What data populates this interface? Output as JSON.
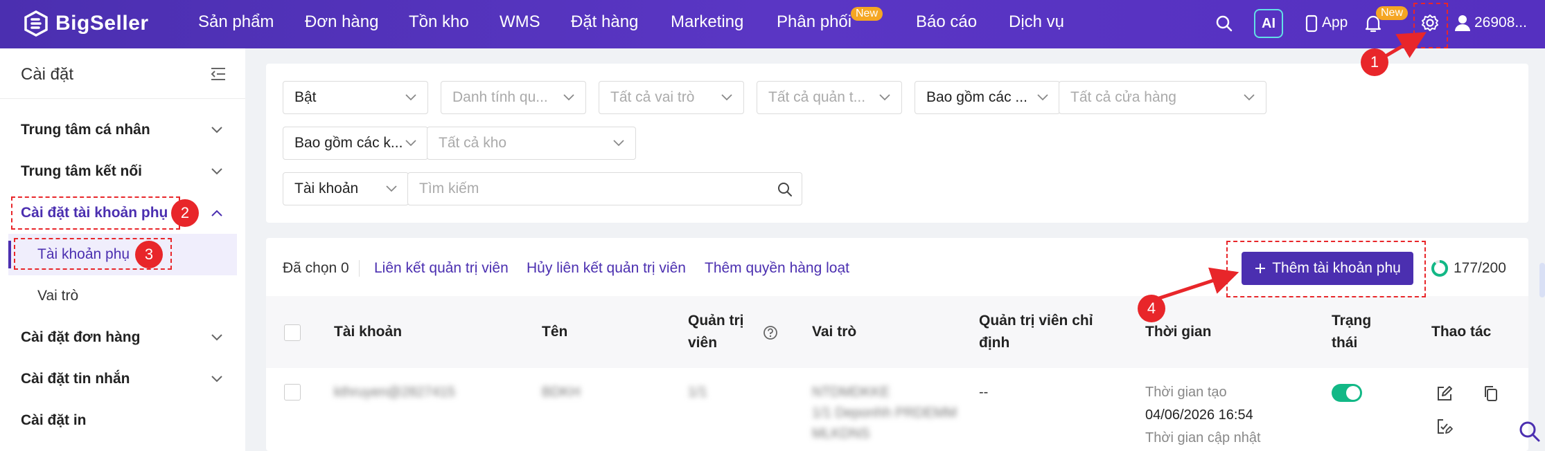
{
  "brand": {
    "name": "BigSeller",
    "accent": "#4b2fb0",
    "annotation_color": "#e8262a"
  },
  "nav": {
    "items": [
      {
        "label": "Sản phẩm"
      },
      {
        "label": "Đơn hàng"
      },
      {
        "label": "Tồn kho"
      },
      {
        "label": "WMS"
      },
      {
        "label": "Đặt hàng"
      },
      {
        "label": "Marketing"
      },
      {
        "label": "Phân phối",
        "badge": "New"
      },
      {
        "label": "Báo cáo"
      },
      {
        "label": "Dịch vụ"
      }
    ],
    "ai_label": "AI",
    "app_label": "App",
    "notification_badge": "New",
    "user_label": "26908..."
  },
  "sidebar": {
    "title": "Cài đặt",
    "items": [
      {
        "label": "Trung tâm cá nhân"
      },
      {
        "label": "Trung tâm kết nối"
      },
      {
        "label": "Cài đặt tài khoản phụ"
      },
      {
        "label": "Tài khoản phụ"
      },
      {
        "label": "Vai trò"
      },
      {
        "label": "Cài đặt đơn hàng"
      },
      {
        "label": "Cài đặt tin nhắn"
      },
      {
        "label": "Cài đặt in"
      }
    ]
  },
  "filters": {
    "status": "Bật",
    "identity": "Danh tính qu...",
    "roles": "Tất cả vai trò",
    "admins": "Tất cả quản t...",
    "include_stores": "Bao gồm các ...",
    "stores": "Tất cả cửa hàng",
    "include_warehouses": "Bao gồm các k...",
    "warehouses": "Tất cả kho",
    "search_type": "Tài khoản",
    "search_placeholder": "Tìm kiếm"
  },
  "toolbar": {
    "selected": "Đã chọn 0",
    "link_admin": "Liên kết quản trị viên",
    "unlink_admin": "Hủy liên kết quản trị viên",
    "bulk_permission": "Thêm quyền hàng loạt",
    "add_button": "Thêm tài khoản phụ",
    "count": "177/200"
  },
  "table": {
    "headers": {
      "account": "Tài khoản",
      "name": "Tên",
      "admin_line1": "Quản trị",
      "admin_line2": "viên",
      "role": "Vai trò",
      "assigned_line1": "Quản trị viên chỉ",
      "assigned_line2": "định",
      "time": "Thời gian",
      "status_line1": "Trạng",
      "status_line2": "thái",
      "actions": "Thao tác"
    },
    "row": {
      "account": "kthruyen@2827415",
      "name": "BDKH",
      "admin": "1/1",
      "role_line1": "NTDMDKKE",
      "role_line2": "1/1 Deponhh PRDEMM",
      "role_line3": "MLKDNS",
      "assigned": "--",
      "created_label": "Thời gian tạo",
      "created_value": "04/06/2026 16:54",
      "updated_label": "Thời gian cập nhật",
      "status": "on"
    }
  },
  "annotations": [
    "1",
    "2",
    "3",
    "4"
  ]
}
